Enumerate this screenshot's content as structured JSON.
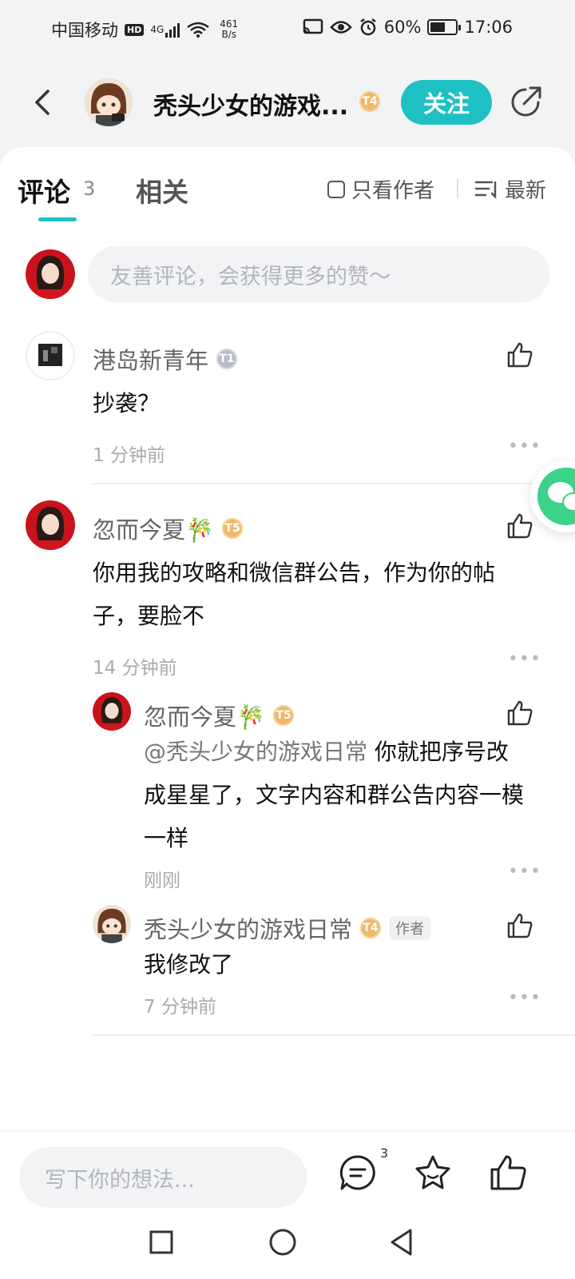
{
  "status_bar": {
    "carrier": "中国移动",
    "hd": "HD",
    "network": "4G",
    "speed_value": "461",
    "speed_unit": "B/s",
    "battery": "60%",
    "battery_level": 0.6,
    "time": "17:06"
  },
  "header": {
    "title": "秃头少女的游戏...",
    "level": "T4",
    "follow_label": "关注"
  },
  "tabs": {
    "comments_label": "评论",
    "comments_count": "3",
    "related_label": "相关",
    "only_author_label": "只看作者",
    "sort_label": "最新"
  },
  "comment_input": {
    "placeholder": "友善评论，会获得更多的赞～"
  },
  "comments": [
    {
      "name": "港岛新青年",
      "level": "T1",
      "text": "抄袭？",
      "time": "1 分钟前"
    },
    {
      "name": "忽而今夏🎋",
      "level": "T5",
      "text": "你用我的攻略和微信群公告，作为你的帖子，要脸不",
      "time": "14 分钟前",
      "replies": [
        {
          "name": "忽而今夏🎋",
          "level": "T5",
          "mention": "@秃头少女的游戏日常",
          "text": "你就把序号改成星星了，文字内容和群公告内容一模一样",
          "time": "刚刚"
        },
        {
          "name": "秃头少女的游戏日常",
          "level": "T4",
          "tag": "作者",
          "text": "我修改了",
          "time": "7 分钟前"
        }
      ]
    }
  ],
  "bottom_bar": {
    "write_placeholder": "写下你的想法...",
    "comment_badge": "3"
  },
  "colors": {
    "accent": "#1fc0c3",
    "level_gold": "#efb86a",
    "level_grey": "#b8bdc8"
  }
}
